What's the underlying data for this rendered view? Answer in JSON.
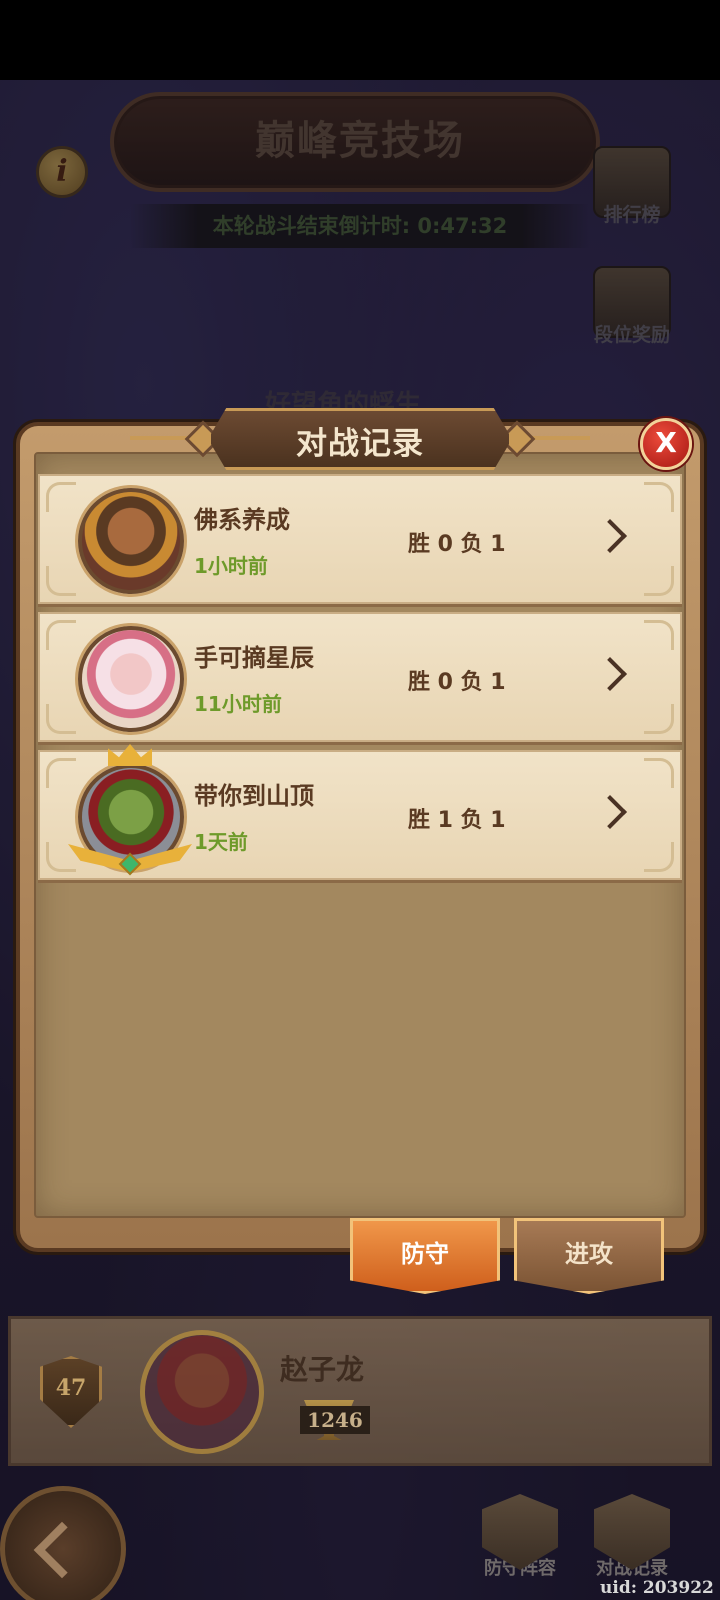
{
  "arena": {
    "title": "巅峰竞技场",
    "countdown": "本轮战斗结束倒计时: 0:47:32",
    "info_label": "i",
    "leaderboard_label": "排行榜",
    "rank_reward_label": "段位奖励",
    "dimmed_player_name": "好望角的蜉生"
  },
  "dialog": {
    "title": "对战记录",
    "close_label": "X",
    "records": [
      {
        "name": "佛系养成",
        "time": "1小时前",
        "score": "胜 0 负 1",
        "avatar": "hero-male-portrait"
      },
      {
        "name": "手可摘星辰",
        "time": "11小时前",
        "score": "胜 0 负 1",
        "avatar": "hero-female-portrait"
      },
      {
        "name": "带你到山顶",
        "time": "1天前",
        "score": "胜 1 负 1",
        "avatar": "orc-warrior-portrait"
      }
    ],
    "tabs": {
      "defend": "防守",
      "attack": "进攻"
    },
    "active_tab": "defend"
  },
  "player": {
    "level": "47",
    "name": "赵子龙",
    "trophies": "1246"
  },
  "nav": {
    "defense_lineup": "防守阵容",
    "battle_record": "对战记录"
  },
  "uid": "uid: 203922",
  "colors": {
    "tab_active": "#e07a30",
    "tab_inactive": "#8b6342",
    "time_green": "#6e9a2a",
    "close_red": "#d2281e"
  }
}
